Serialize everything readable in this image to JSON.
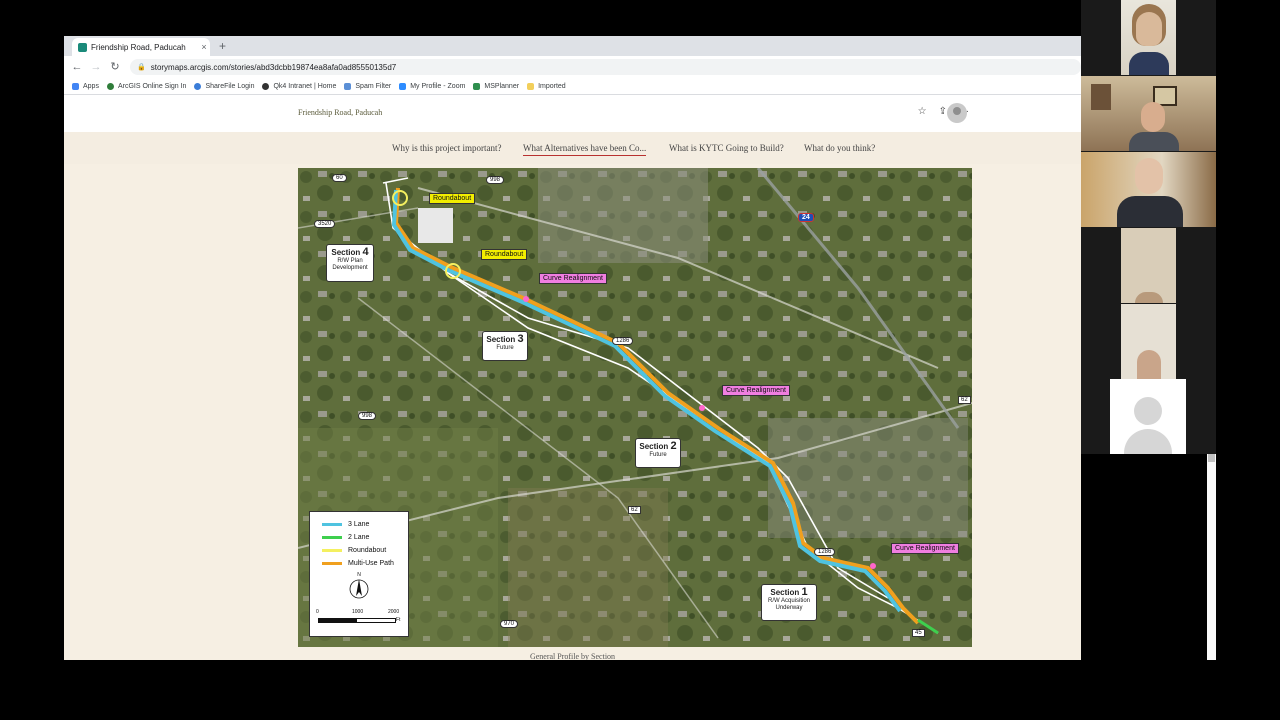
{
  "browser": {
    "tab_title": "Friendship Road, Paducah",
    "tab_close": "×",
    "new_tab": "+",
    "url": "storymaps.arcgis.com/stories/abd3dcbb19874ea8afa0ad85550135d7",
    "back": "←",
    "forward": "→",
    "reload": "↻"
  },
  "bookmarks": [
    {
      "label": "Apps",
      "color": "#4285f4"
    },
    {
      "label": "ArcGIS Online Sign In",
      "color": "#2f7d3a"
    },
    {
      "label": "ShareFile Login",
      "color": "#3b7dd8"
    },
    {
      "label": "Qk4 Intranet | Home",
      "color": "#333333"
    },
    {
      "label": "Spam Filter",
      "color": "#5b8fd6"
    },
    {
      "label": "My Profile - Zoom",
      "color": "#2d8cff"
    },
    {
      "label": "MSPlanner",
      "color": "#2f8f4e"
    },
    {
      "label": "Imported",
      "color": "#f2cf5b"
    }
  ],
  "story": {
    "header_title": "Friendship Road, Paducah",
    "nav": [
      "Why is this project important?",
      "What Alternatives have been Co...",
      "What is KYTC Going to Build?",
      "What do you think?"
    ],
    "active_nav_index": 1,
    "caption": "General Profile by Section"
  },
  "map": {
    "labels": {
      "roundabout_1": "Roundabout",
      "roundabout_2": "Roundabout",
      "curve_1": "Curve Realignment",
      "curve_2": "Curve Realignment",
      "curve_3": "Curve Realignment",
      "section4_title": "Section",
      "section4_num": "4",
      "section4_sub1": "R/W Plan",
      "section4_sub2": "Development",
      "section3_title": "Section",
      "section3_num": "3",
      "section3_sub": "Future",
      "section2_title": "Section",
      "section2_num": "2",
      "section2_sub": "Future",
      "section1_title": "Section",
      "section1_num": "1",
      "section1_sub1": "R/W Acquisition",
      "section1_sub2": "Underway",
      "shield_60": "60",
      "shield_998a": "998",
      "shield_998b": "998",
      "shield_3520": "3520",
      "shield_24": "24",
      "shield_1286a": "1286",
      "shield_1286b": "1286",
      "shield_62a": "62",
      "shield_62b": "62",
      "shield_970": "970",
      "shield_45": "45"
    },
    "legend": {
      "items": [
        {
          "label": "3 Lane",
          "color": "#4fc3e0"
        },
        {
          "label": "2 Lane",
          "color": "#3ecf4e"
        },
        {
          "label": "Roundabout",
          "color": "#f4f060"
        },
        {
          "label": "Multi-Use Path",
          "color": "#f0a01e"
        }
      ],
      "north": "N",
      "scale": [
        "0",
        "1000",
        "2000"
      ],
      "unit": "Ft"
    }
  }
}
